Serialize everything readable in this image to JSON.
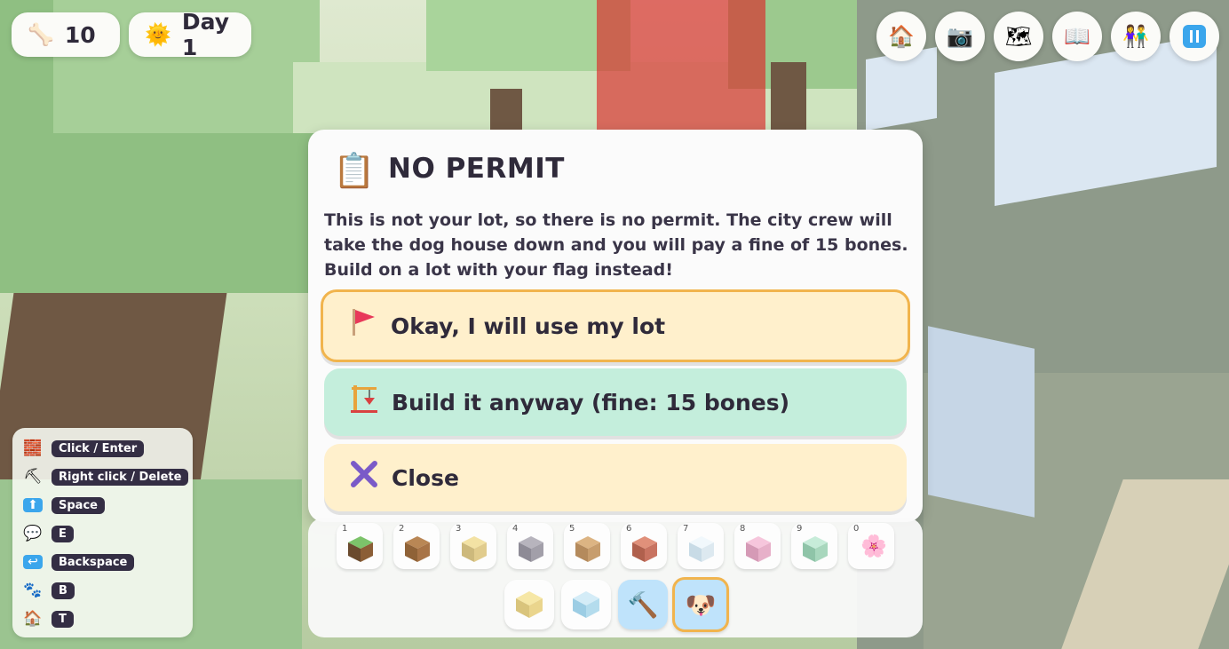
{
  "hud": {
    "bones_icon": "bone-icon",
    "bones_count": "10",
    "day_icon": "sun-icon",
    "day_label": "Day 1"
  },
  "top_buttons": [
    {
      "name": "home-icon",
      "glyph": "🏠"
    },
    {
      "name": "camera-icon",
      "glyph": "📷"
    },
    {
      "name": "map-icon",
      "glyph": "🗺"
    },
    {
      "name": "book-icon",
      "glyph": "📖"
    },
    {
      "name": "friends-icon",
      "glyph": "👫"
    },
    {
      "name": "pause-icon",
      "glyph": "⏸"
    }
  ],
  "dialog": {
    "icon": "clipboard-icon",
    "title": "NO PERMIT",
    "message": "This is not your lot, so there is no permit. The city crew will take the dog house down and you will pay a fine of 15 bones. Build on a lot with your flag instead!",
    "options": {
      "use_lot": {
        "icon": "flag-icon",
        "label": "Okay, I will use my lot"
      },
      "build_anyway": {
        "icon": "crane-icon",
        "label": "Build it anyway (fine: 15 bones)"
      },
      "close": {
        "icon": "x-icon",
        "label": "Close"
      }
    }
  },
  "controls": [
    {
      "icon": "brick-icon",
      "glyph": "🧱",
      "key": "Click / Enter"
    },
    {
      "icon": "pickaxe-icon",
      "glyph": "⛏",
      "key": "Right click / Delete"
    },
    {
      "icon": "up-arrow-icon",
      "glyph": "⬆",
      "key": "Space"
    },
    {
      "icon": "speech-bubble-icon",
      "glyph": "💬",
      "key": "E"
    },
    {
      "icon": "return-icon",
      "glyph": "↩",
      "key": "Backspace"
    },
    {
      "icon": "paw-icon",
      "glyph": "🐾",
      "key": "B"
    },
    {
      "icon": "house-icon",
      "glyph": "🏠",
      "key": "T"
    }
  ],
  "hotbar": {
    "slots": [
      {
        "num": "1",
        "block": "grass",
        "top": "#7cc36a",
        "left": "#6a4a2e",
        "right": "#8b5e36"
      },
      {
        "num": "2",
        "block": "wood",
        "top": "#b98755",
        "left": "#8f6237",
        "right": "#a87447"
      },
      {
        "num": "3",
        "block": "sand",
        "top": "#f3e2a4",
        "left": "#cdb97c",
        "right": "#e1cc8d"
      },
      {
        "num": "4",
        "block": "stone",
        "top": "#b7b4bd",
        "left": "#8e8b96",
        "right": "#a29fa9"
      },
      {
        "num": "5",
        "block": "plank",
        "top": "#dcb483",
        "left": "#b48a5c",
        "right": "#c79d6d"
      },
      {
        "num": "6",
        "block": "brick",
        "top": "#e0907a",
        "left": "#b0604d",
        "right": "#c87361"
      },
      {
        "num": "7",
        "block": "ice",
        "top": "#f1f8fc",
        "left": "#c8dbe6",
        "right": "#dde9f0"
      },
      {
        "num": "8",
        "block": "pink",
        "top": "#f6c6dc",
        "left": "#d59ab6",
        "right": "#e7b0c9"
      },
      {
        "num": "9",
        "block": "mint",
        "top": "#c7ecd9",
        "left": "#8fc4a8",
        "right": "#a8d7bd"
      },
      {
        "num": "0",
        "block": "flower",
        "glyph": "🌸"
      }
    ],
    "tools": [
      {
        "name": "yellow-block-tool",
        "glyph": "yellow-cube"
      },
      {
        "name": "water-block-tool",
        "glyph": "water-cube"
      },
      {
        "name": "hammer-icon",
        "glyph": "🔨"
      },
      {
        "name": "dog-icon",
        "glyph": "🐶"
      }
    ]
  }
}
